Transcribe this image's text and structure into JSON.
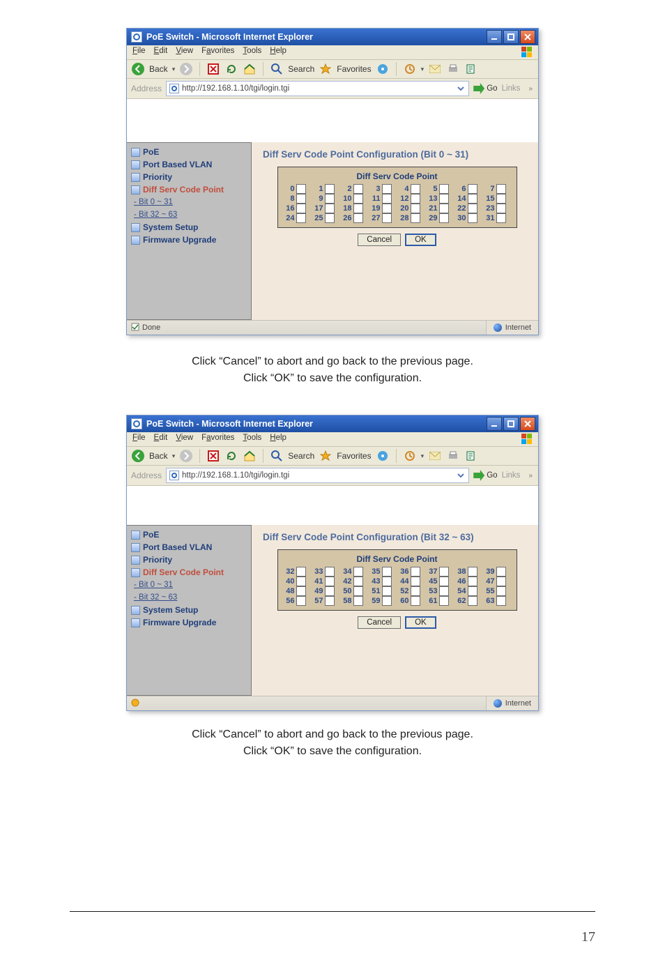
{
  "browser": {
    "title": "PoE Switch - Microsoft Internet Explorer",
    "menu": {
      "file": "File",
      "edit": "Edit",
      "view": "View",
      "favorites": "Favorites",
      "tools": "Tools",
      "help": "Help"
    },
    "toolbar": {
      "back": "Back",
      "search": "Search",
      "favorites": "Favorites"
    },
    "addressbar": {
      "label": "Address",
      "url": "http://192.168.1.10/tgi/login.tgi",
      "go": "Go",
      "links": "Links"
    },
    "statusbar": {
      "internet": "Internet",
      "done": "Done"
    }
  },
  "sidebar": {
    "items": {
      "poe": "PoE",
      "vlan": "Port Based VLAN",
      "priority": "Priority",
      "dscp": "Diff Serv Code Point",
      "bit_a": "- Bit 0 ~ 31",
      "bit_b": "- Bit 32 ~ 63",
      "system": "System Setup",
      "firmware": "Firmware Upgrade"
    }
  },
  "panel1": {
    "title": "Diff Serv Code Point Configuration (Bit 0 ~ 31)",
    "caption": "Diff Serv Code Point",
    "cancel": "Cancel",
    "ok": "OK",
    "rowStart": 0
  },
  "panel2": {
    "title": "Diff Serv Code Point Configuration (Bit 32 ~ 63)",
    "caption": "Diff Serv Code Point",
    "cancel": "Cancel",
    "ok": "OK",
    "rowStart": 32
  },
  "captions": {
    "line1": "Click “Cancel” to abort and go back to the previous page.",
    "line2": "Click “OK” to save the configuration."
  },
  "page_number": "17"
}
